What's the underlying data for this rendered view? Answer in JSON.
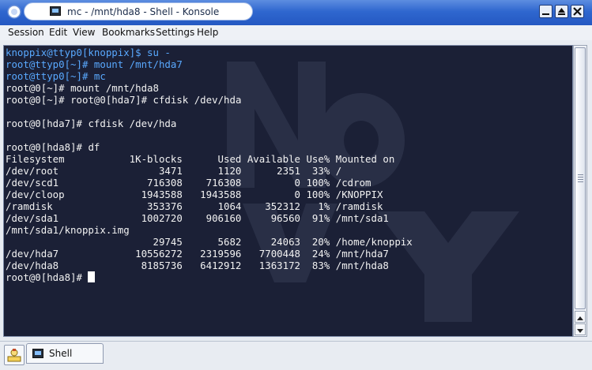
{
  "window": {
    "title": "mc - /mnt/hda8 - Shell - Konsole"
  },
  "menu": [
    "Session",
    "Edit",
    "View",
    "Bookmarks",
    "Settings",
    "Help"
  ],
  "terminal": {
    "lines": [
      {
        "prompt": "knoppix@ttyp0[knoppix]$",
        "cmd": " su -",
        "user": true
      },
      {
        "prompt": "root@ttyp0[~]#",
        "cmd": " mount /mnt/hda7",
        "user": true
      },
      {
        "prompt": "root@ttyp0[~]#",
        "cmd": " mc",
        "user": true
      },
      {
        "prompt": "root@0[~]#",
        "cmd": " mount /mnt/hda8",
        "user": false
      },
      {
        "prompt": "root@0[~]#",
        "cmd": " root@0[hda7]# cfdisk /dev/hda",
        "user": false
      },
      {
        "prompt": "",
        "cmd": "",
        "user": false
      },
      {
        "prompt": "root@0[hda7]#",
        "cmd": " cfdisk /dev/hda",
        "user": false
      },
      {
        "prompt": "",
        "cmd": "",
        "user": false
      },
      {
        "prompt": "root@0[hda8]#",
        "cmd": " df",
        "user": false
      },
      {
        "prompt": "",
        "cmd": "Filesystem           1K-blocks      Used Available Use% Mounted on",
        "user": false
      },
      {
        "prompt": "",
        "cmd": "/dev/root                 3471      1120      2351  33% /",
        "user": false
      },
      {
        "prompt": "",
        "cmd": "/dev/scd1               716308    716308         0 100% /cdrom",
        "user": false
      },
      {
        "prompt": "",
        "cmd": "/dev/cloop             1943588   1943588         0 100% /KNOPPIX",
        "user": false
      },
      {
        "prompt": "",
        "cmd": "/ramdisk                353376      1064    352312   1% /ramdisk",
        "user": false
      },
      {
        "prompt": "",
        "cmd": "/dev/sda1              1002720    906160     96560  91% /mnt/sda1",
        "user": false
      },
      {
        "prompt": "",
        "cmd": "/mnt/sda1/knoppix.img",
        "user": false
      },
      {
        "prompt": "",
        "cmd": "                         29745      5682     24063  20% /home/knoppix",
        "user": false
      },
      {
        "prompt": "",
        "cmd": "/dev/hda7             10556272   2319596   7700448  24% /mnt/hda7",
        "user": false
      },
      {
        "prompt": "",
        "cmd": "/dev/hda8              8185736   6412912   1363172  83% /mnt/hda8",
        "user": false
      },
      {
        "prompt": "root@0[hda8]#",
        "cmd": " ",
        "user": false,
        "cursor": true
      }
    ]
  },
  "tabbar": {
    "tab_label": "Shell"
  },
  "colors": {
    "terminal_bg": "#1b2036",
    "user_prompt": "#59a9ff",
    "text": "#f2f2f2",
    "titlebar": "#2f67cf"
  },
  "icons": [
    "window-menu-icon",
    "konsole-icon",
    "minimize-icon",
    "maximize-icon",
    "close-icon",
    "new-session-icon",
    "shell-icon"
  ]
}
